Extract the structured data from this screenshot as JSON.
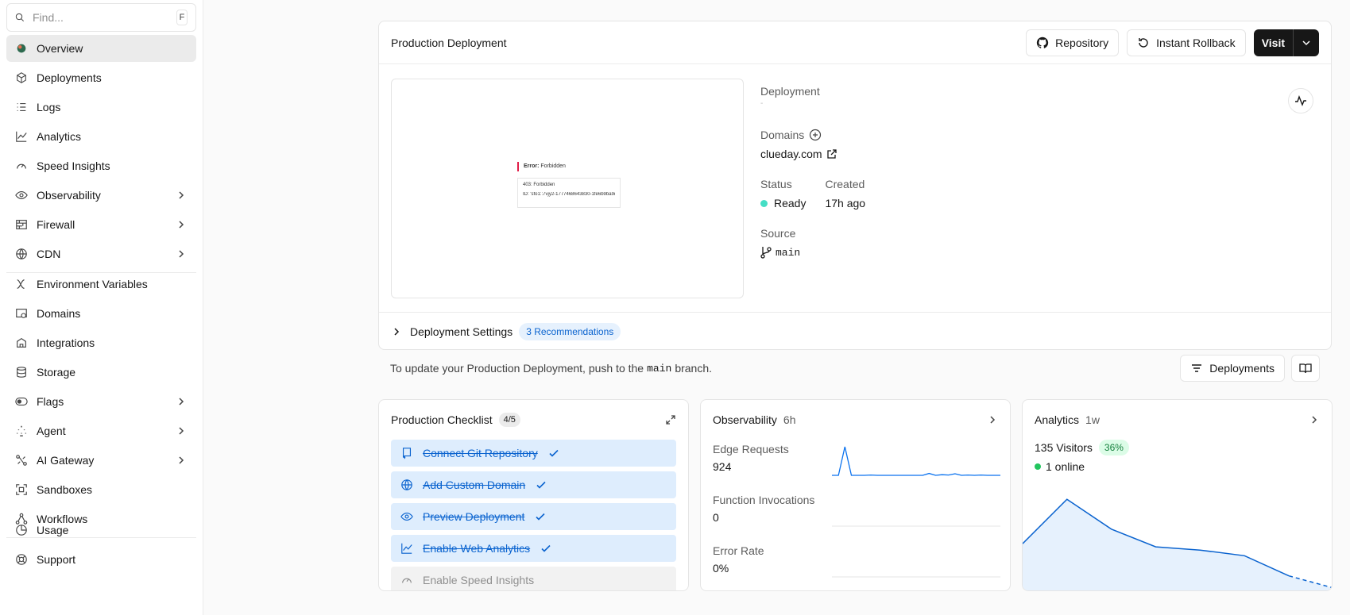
{
  "sidebar": {
    "search_placeholder": "Find...",
    "search_shortcut": "F",
    "groups": [
      [
        {
          "label": "Overview",
          "icon": "project-avatar-icon",
          "active": true,
          "chevron": false
        },
        {
          "label": "Deployments",
          "icon": "cube-icon",
          "chevron": false
        },
        {
          "label": "Logs",
          "icon": "list-icon",
          "chevron": false
        },
        {
          "label": "Analytics",
          "icon": "line-chart-icon",
          "chevron": false
        },
        {
          "label": "Speed Insights",
          "icon": "gauge-icon",
          "chevron": false
        },
        {
          "label": "Observability",
          "icon": "eye-icon",
          "chevron": true
        },
        {
          "label": "Firewall",
          "icon": "firewall-icon",
          "chevron": true
        },
        {
          "label": "CDN",
          "icon": "globe-icon",
          "chevron": true
        }
      ],
      [
        {
          "label": "Environment Variables",
          "icon": "variable-icon",
          "chevron": false
        },
        {
          "label": "Domains",
          "icon": "domain-icon",
          "chevron": false
        },
        {
          "label": "Integrations",
          "icon": "integrations-icon",
          "chevron": false
        },
        {
          "label": "Storage",
          "icon": "database-icon",
          "chevron": false
        },
        {
          "label": "Flags",
          "icon": "toggle-icon",
          "chevron": true
        },
        {
          "label": "Agent",
          "icon": "agent-icon",
          "chevron": true
        },
        {
          "label": "AI Gateway",
          "icon": "gateway-icon",
          "chevron": true
        },
        {
          "label": "Sandboxes",
          "icon": "sandbox-icon",
          "chevron": false
        },
        {
          "label": "Workflows",
          "icon": "workflow-icon",
          "chevron": false
        }
      ],
      [
        {
          "label": "Usage",
          "icon": "pie-icon",
          "chevron": false
        },
        {
          "label": "Support",
          "icon": "support-icon",
          "chevron": false
        }
      ]
    ]
  },
  "production": {
    "title": "Production Deployment",
    "repository_label": "Repository",
    "rollback_label": "Instant Rollback",
    "visit_label": "Visit",
    "preview": {
      "error_label": "Error:",
      "error_text": "Forbidden",
      "code_text": "403: Forbidden",
      "id_text": "ID: 'sfo1::7vjy2-1777468643830-1fe6b9ba9d0'"
    },
    "deployment_label": "Deployment",
    "deployment_value": "-",
    "domains_label": "Domains",
    "domain": "clueday.com",
    "status_label": "Status",
    "status_value": "Ready",
    "status_color": "#45dec5",
    "created_label": "Created",
    "created_value": "17h ago",
    "source_label": "Source",
    "source_value": "main",
    "settings_label": "Deployment Settings",
    "recommendations": "3 Recommendations"
  },
  "update": {
    "prefix": "To update your Production Deployment, push to the",
    "branch": "main",
    "suffix": "branch.",
    "deployments_button": "Deployments"
  },
  "checklist": {
    "title": "Production Checklist",
    "count": "4/5",
    "items": [
      {
        "label": "Connect Git Repository",
        "done": true,
        "icon": "repo-icon"
      },
      {
        "label": "Add Custom Domain",
        "done": true,
        "icon": "globe-icon"
      },
      {
        "label": "Preview Deployment",
        "done": true,
        "icon": "preview-icon"
      },
      {
        "label": "Enable Web Analytics",
        "done": true,
        "icon": "line-chart-icon"
      },
      {
        "label": "Enable Speed Insights",
        "done": false,
        "icon": "gauge-icon"
      }
    ]
  },
  "observability": {
    "title": "Observability",
    "range": "6h",
    "metrics": [
      {
        "label": "Edge Requests",
        "value": "924"
      },
      {
        "label": "Function Invocations",
        "value": "0"
      },
      {
        "label": "Error Rate",
        "value": "0%"
      }
    ],
    "accent": "#0a72ef"
  },
  "analytics": {
    "title": "Analytics",
    "range": "1w",
    "visitors": "135 Visitors",
    "change": "36%",
    "online": "1 online",
    "online_color": "#22c55e"
  },
  "chart_data": [
    {
      "type": "line",
      "series": [
        {
          "values": [
            0,
            0,
            90,
            0,
            0,
            0,
            1,
            0,
            0,
            0,
            0,
            0,
            0,
            0,
            0,
            6,
            0,
            2,
            1,
            5,
            0,
            1,
            0,
            1,
            0,
            0,
            0
          ]
        }
      ]
    },
    {
      "type": "area",
      "series": [
        {
          "values": [
            60,
            115,
            78,
            56,
            52,
            45,
            20
          ],
          "projected": [
            20,
            5
          ]
        }
      ]
    }
  ]
}
